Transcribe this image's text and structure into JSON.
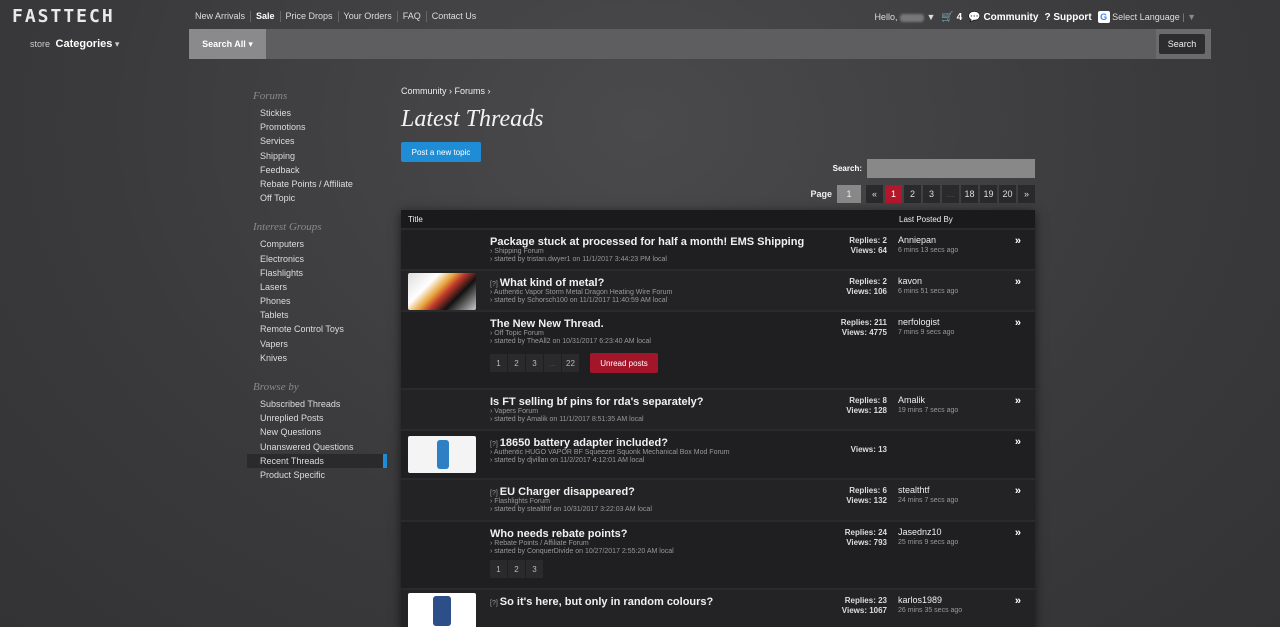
{
  "header": {
    "logo": "FASTTECH",
    "nav": [
      "New Arrivals",
      "Sale",
      "Price Drops",
      "Your Orders",
      "FAQ",
      "Contact Us"
    ],
    "greeting": "Hello,",
    "cart_count": "4",
    "community": "Community",
    "support": "Support",
    "language": "Select Language"
  },
  "search": {
    "store_label": "store",
    "categories": "Categories",
    "scope": "Search All",
    "button": "Search"
  },
  "sidebar": {
    "forums_title": "Forums",
    "forums": [
      "Stickies",
      "Promotions",
      "Services",
      "Shipping",
      "Feedback",
      "Rebate Points / Affiliate",
      "Off Topic"
    ],
    "groups_title": "Interest Groups",
    "groups": [
      "Computers",
      "Electronics",
      "Flashlights",
      "Lasers",
      "Phones",
      "Tablets",
      "Remote Control Toys",
      "Vapers",
      "Knives"
    ],
    "browse_title": "Browse by",
    "browse": [
      "Subscribed Threads",
      "Unreplied Posts",
      "New Questions",
      "Unanswered Questions",
      "Recent Threads",
      "Product Specific"
    ],
    "active_browse": "Recent Threads"
  },
  "main": {
    "breadcrumb": "Community › Forums ›",
    "title": "Latest Threads",
    "post_button": "Post a new topic",
    "search_label": "Search:",
    "page_label": "Page",
    "page_input": "1",
    "pager": [
      "«",
      "1",
      "2",
      "3",
      "...",
      "18",
      "19",
      "20",
      "»"
    ],
    "current_page": "1",
    "col_title": "Title",
    "col_last": "Last Posted By"
  },
  "threads": [
    {
      "title": "Package stuck at processed for half a month! EMS Shipping",
      "question": "",
      "forum": "› Shipping Forum",
      "starter": "› started by tristan.dwyer1 on 11/1/2017 3:44:23 PM local",
      "replies": "Replies: 2",
      "views": "Views: 64",
      "last_user": "Anniepan",
      "last_ago": "6 mins 13 secs ago"
    },
    {
      "title": "What kind of metal?",
      "question": "[?]",
      "forum": "› Authentic Vapor Storm Metal Dragon Heating Wire Forum",
      "starter": "› started by Schorsch100 on 11/1/2017 11:40:59 AM local",
      "replies": "Replies: 2",
      "views": "Views: 106",
      "last_user": "kavon",
      "last_ago": "6 mins 51 secs ago"
    },
    {
      "title": "The New New Thread.",
      "question": "",
      "forum": "› Off Topic Forum",
      "starter": "› started by TheAll2 on 10/31/2017 6:23:40 AM local",
      "replies": "Replies: 211",
      "views": "Views: 4775",
      "last_user": "nerfologist",
      "last_ago": "7 mins 9 secs ago",
      "pages": [
        "1",
        "2",
        "3",
        "...",
        "22"
      ],
      "unread": "Unread posts"
    },
    {
      "title": "Is FT selling bf pins for rda's separately?",
      "question": "",
      "forum": "› Vapers Forum",
      "starter": "› started by Amalik on 11/1/2017 8:51:35 AM local",
      "replies": "Replies: 8",
      "views": "Views: 128",
      "last_user": "Amalik",
      "last_ago": "19 mins 7 secs ago"
    },
    {
      "title": "18650 battery adapter included?",
      "question": "[?]",
      "forum": "› Authentic HUGO VAPOR BF Squeezer Squonk Mechanical Box Mod Forum",
      "starter": "› started by djvillan on 11/2/2017 4:12:01 AM local",
      "replies": "",
      "views": "Views: 13",
      "last_user": "",
      "last_ago": ""
    },
    {
      "title": "EU Charger disappeared?",
      "question": "[?]",
      "forum": "› Flashlights Forum",
      "starter": "› started by stealthtf on 10/31/2017 3:22:03 AM local",
      "replies": "Replies: 6",
      "views": "Views: 132",
      "last_user": "stealthtf",
      "last_ago": "24 mins 7 secs ago"
    },
    {
      "title": "Who needs rebate points?",
      "question": "",
      "forum": "› Rebate Points / Affiliate Forum",
      "starter": "› started by ConquerDivide on 10/27/2017 2:55:20 AM local",
      "replies": "Replies: 24",
      "views": "Views: 793",
      "last_user": "Jasednz10",
      "last_ago": "25 mins 9 secs ago",
      "pages": [
        "1",
        "2",
        "3"
      ]
    },
    {
      "title": "So it's here, but only in random colours?",
      "question": "[?]",
      "forum": "",
      "starter": "",
      "replies": "Replies: 23",
      "views": "Views: 1067",
      "last_user": "karlos1989",
      "last_ago": "26 mins 35 secs ago"
    }
  ]
}
